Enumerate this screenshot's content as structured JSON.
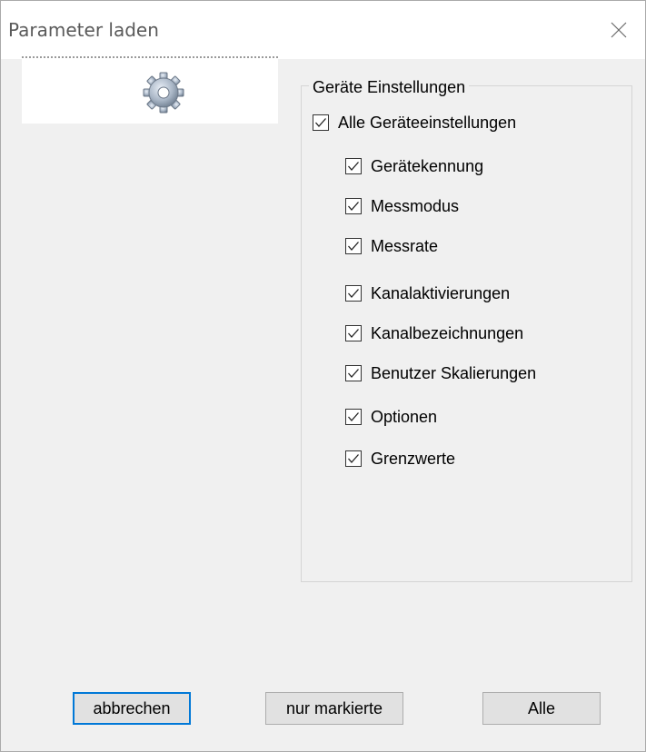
{
  "window": {
    "title": "Parameter laden"
  },
  "group": {
    "title": "Geräte Einstellungen",
    "master": {
      "label": "Alle Geräteeinstellungen",
      "checked": true
    },
    "items": [
      {
        "label": "Gerätekennung",
        "checked": true
      },
      {
        "label": "Messmodus",
        "checked": true
      },
      {
        "label": "Messrate",
        "checked": true
      },
      {
        "label": "Kanalaktivierungen",
        "checked": true
      },
      {
        "label": "Kanalbezeichnungen",
        "checked": true
      },
      {
        "label": "Benutzer Skalierungen",
        "checked": true
      },
      {
        "label": "Optionen",
        "checked": true
      },
      {
        "label": "Grenzwerte",
        "checked": true
      }
    ]
  },
  "buttons": {
    "cancel": "abbrechen",
    "marked": "nur markierte",
    "all": "Alle"
  },
  "icons": {
    "close": "close-icon",
    "settings": "gear-icon",
    "check": "checkmark-icon"
  },
  "colors": {
    "accent": "#0078d7"
  }
}
